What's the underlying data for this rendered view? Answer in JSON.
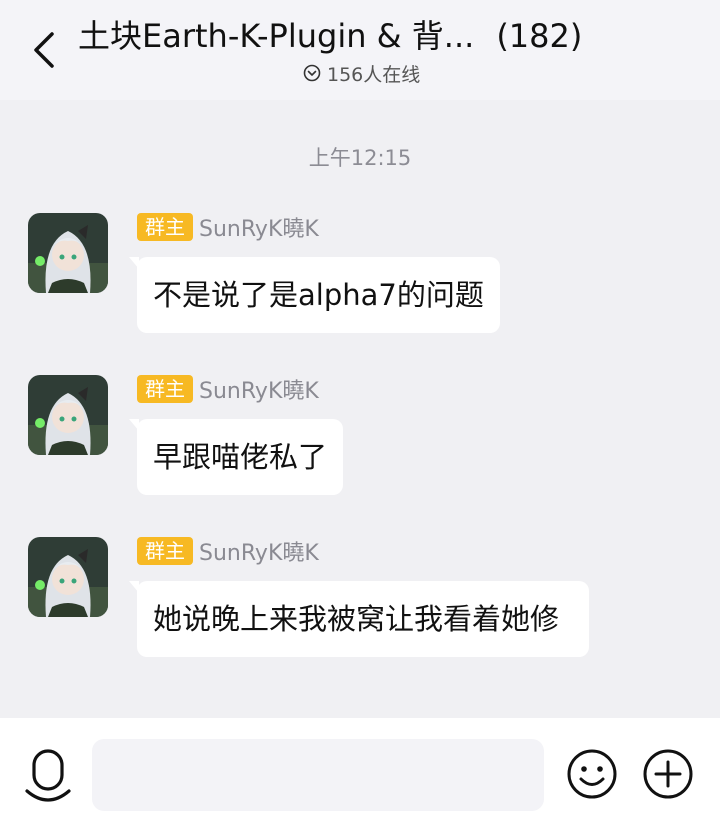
{
  "header": {
    "title": "土块Earth-K-Plugin & 背...",
    "member_count": "(182)",
    "online": "156人在线"
  },
  "timestamp": "上午12:15",
  "messages": [
    {
      "badge": "群主",
      "sender": "SunRyK曉K",
      "text": "不是说了是alpha7的问题"
    },
    {
      "badge": "群主",
      "sender": "SunRyK曉K",
      "text": "早跟喵佬私了"
    },
    {
      "badge": "群主",
      "sender": "SunRyK曉K",
      "text": "她说晚上来我被窝让我看着她修"
    }
  ],
  "input": {
    "value": "",
    "placeholder": ""
  },
  "colors": {
    "badge": "#f7b923",
    "background": "#f0f0f3",
    "bubble": "#ffffff"
  }
}
